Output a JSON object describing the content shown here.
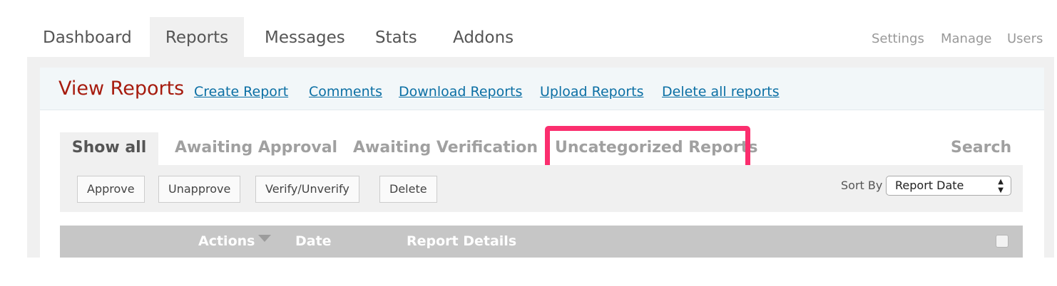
{
  "nav": {
    "tabs": [
      "Dashboard",
      "Reports",
      "Messages",
      "Stats",
      "Addons"
    ],
    "active_tab": "Reports",
    "right_links": [
      "Settings",
      "Manage",
      "Users"
    ]
  },
  "subheader": {
    "title": "View Reports",
    "links": [
      "Create Report",
      "Comments",
      "Download Reports",
      "Upload Reports",
      "Delete all reports"
    ]
  },
  "filters": {
    "tabs": [
      "Show all",
      "Awaiting Approval",
      "Awaiting Verification",
      "Uncategorized Reports"
    ],
    "active": "Show all",
    "search_label": "Search"
  },
  "toolbar": {
    "buttons": [
      "Approve",
      "Unapprove",
      "Verify/Unverify",
      "Delete"
    ],
    "sort_label": "Sort By",
    "sort_value": "Report Date"
  },
  "table": {
    "columns": [
      "Actions",
      "Date",
      "Report Details"
    ]
  },
  "colors": {
    "title": "#a61b0e",
    "link": "#0b6fa4",
    "highlight": "#fb2e6e"
  }
}
